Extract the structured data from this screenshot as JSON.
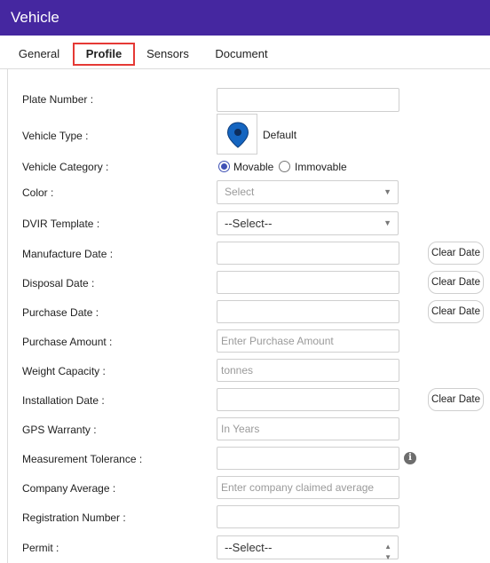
{
  "header": {
    "title": "Vehicle"
  },
  "tabs": [
    {
      "label": "General"
    },
    {
      "label": "Profile",
      "active": true
    },
    {
      "label": "Sensors"
    },
    {
      "label": "Document"
    }
  ],
  "form": {
    "plate_number": {
      "label": "Plate Number :",
      "value": ""
    },
    "vehicle_type": {
      "label": "Vehicle Type :",
      "icon": "map-pin-icon",
      "icon_color": "#1565c0",
      "value": "Default"
    },
    "vehicle_category": {
      "label": "Vehicle Category :",
      "options": [
        "Movable",
        "Immovable"
      ],
      "selected": "Movable"
    },
    "color": {
      "label": "Color :",
      "value": "Select"
    },
    "dvir_template": {
      "label": "DVIR Template :",
      "value": "--Select--"
    },
    "manufacture_date": {
      "label": "Manufacture Date :",
      "value": "",
      "clear_label": "Clear Date"
    },
    "disposal_date": {
      "label": "Disposal Date :",
      "value": "",
      "clear_label": "Clear Date"
    },
    "purchase_date": {
      "label": "Purchase Date :",
      "value": "",
      "clear_label": "Clear Date"
    },
    "purchase_amount": {
      "label": "Purchase Amount :",
      "placeholder": "Enter Purchase Amount"
    },
    "weight_capacity": {
      "label": "Weight Capacity :",
      "placeholder": "tonnes"
    },
    "installation_date": {
      "label": "Installation Date :",
      "value": "",
      "clear_label": "Clear Date"
    },
    "gps_warranty": {
      "label": "GPS Warranty :",
      "placeholder": "In Years"
    },
    "measurement_tolerance": {
      "label": "Measurement Tolerance :",
      "value": "",
      "info_icon": "info-icon"
    },
    "company_average": {
      "label": "Company Average :",
      "placeholder": "Enter company claimed average"
    },
    "registration_number": {
      "label": "Registration Number :",
      "value": ""
    },
    "permit": {
      "label": "Permit :",
      "value": "--Select--"
    }
  },
  "colors": {
    "header_bg": "#4527a0",
    "active_tab_border": "#e53935",
    "radio_accent": "#3f51b5"
  }
}
